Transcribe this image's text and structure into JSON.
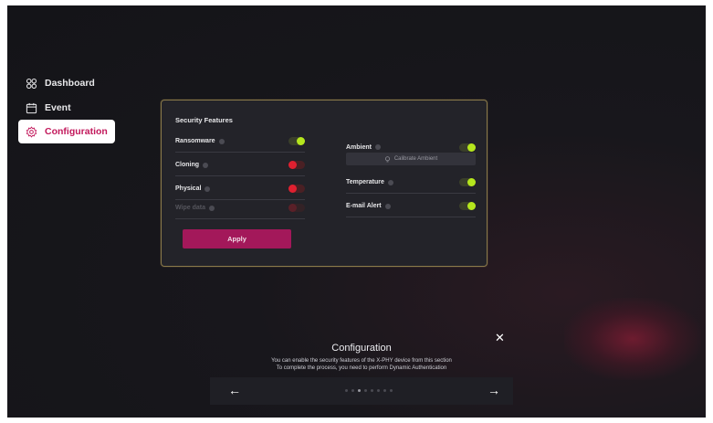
{
  "sidebar": {
    "items": [
      {
        "label": "Dashboard",
        "icon": "grid-icon",
        "active": false
      },
      {
        "label": "Event",
        "icon": "calendar-icon",
        "active": false
      },
      {
        "label": "Configuration",
        "icon": "gear-icon",
        "active": true
      }
    ]
  },
  "security_panel": {
    "title": "Security Features",
    "left_features": [
      {
        "label": "Ransomware",
        "state": "on"
      },
      {
        "label": "Cloning",
        "state": "off"
      },
      {
        "label": "Physical",
        "state": "off"
      },
      {
        "label": "Wipe data",
        "state": "disabled"
      }
    ],
    "right_features": [
      {
        "label": "Ambient",
        "state": "on"
      },
      {
        "label": "Temperature",
        "state": "on"
      },
      {
        "label": "E-mail Alert",
        "state": "on"
      }
    ],
    "calibrate_label": "Calibrate Ambient",
    "apply_label": "Apply"
  },
  "tour": {
    "title": "Configuration",
    "line1": "You can enable the security features of the X-PHY device from this section",
    "line2": "To complete the process, you need to perform Dynamic Authentication",
    "prev": "←",
    "next": "→",
    "close": "✕",
    "step_count": 8,
    "current_step": 3
  },
  "colors": {
    "accent": "#a3185a",
    "toggle_on": "#b5e61d",
    "toggle_off": "#e02030"
  }
}
